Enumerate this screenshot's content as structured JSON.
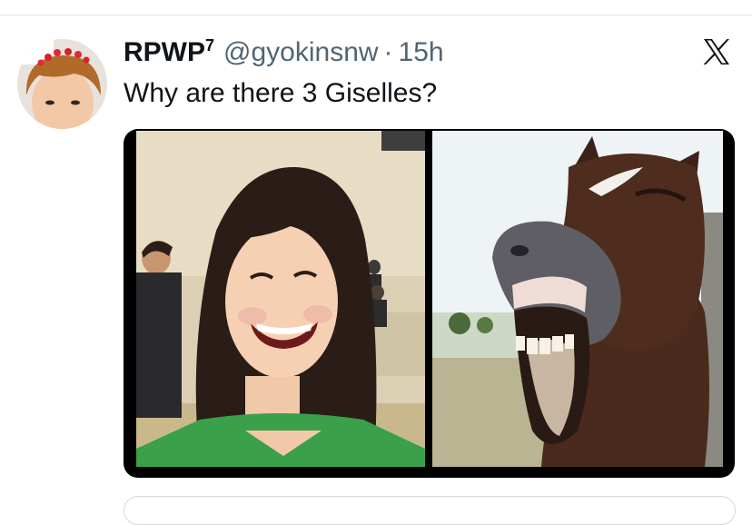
{
  "tweet": {
    "display_name": "RPWP",
    "name_superscript": "7",
    "handle": "@gyokinsnw",
    "separator": "·",
    "time": "15h",
    "text": "Why are there 3 Giselles?"
  },
  "header_icon": "x-logo-icon",
  "avatar_icon": "profile-avatar",
  "media": {
    "left_image": "woman-laughing-photo",
    "right_image": "horse-laughing-photo"
  }
}
